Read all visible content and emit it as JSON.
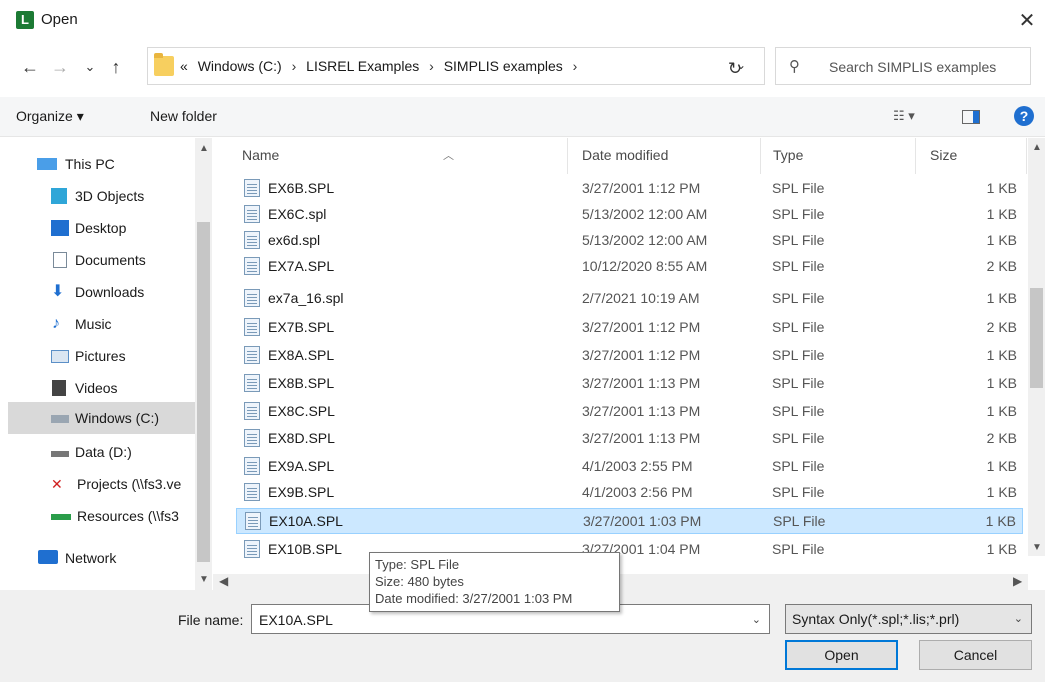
{
  "window": {
    "app_icon_letter": "L",
    "title": "Open",
    "close_glyph": "✕"
  },
  "nav": {
    "back_glyph": "←",
    "forward_glyph": "→",
    "recent_glyph": "⌄",
    "up_glyph": "↑",
    "breadcrumb_prefix": "«",
    "breadcrumbs": [
      "Windows (C:)",
      "LISREL Examples",
      "SIMPLIS examples"
    ],
    "refresh_glyph": "↻",
    "search_placeholder": "Search SIMPLIS examples"
  },
  "toolbar": {
    "organize_label": "Organize ▾",
    "new_folder_label": "New folder",
    "views_glyph": "☷ ▾",
    "help_glyph": "?"
  },
  "sidebar": {
    "items": [
      {
        "label": "This PC",
        "icon": "this-pc-icon",
        "color": "#4a9ee8"
      },
      {
        "label": "3D Objects",
        "icon": "3d-objects-icon",
        "color": "#2fa6d8"
      },
      {
        "label": "Desktop",
        "icon": "desktop-icon",
        "color": "#1f6fd0"
      },
      {
        "label": "Documents",
        "icon": "documents-icon",
        "color": "#7a8a99"
      },
      {
        "label": "Downloads",
        "icon": "downloads-icon",
        "color": "#1f6fd0"
      },
      {
        "label": "Music",
        "icon": "music-icon",
        "color": "#1f6fd0"
      },
      {
        "label": "Pictures",
        "icon": "pictures-icon",
        "color": "#5b8fc7"
      },
      {
        "label": "Videos",
        "icon": "videos-icon",
        "color": "#444444"
      },
      {
        "label": "Windows (C:)",
        "icon": "drive-c-icon",
        "color": "#7a8a99"
      },
      {
        "label": "Data (D:)",
        "icon": "drive-d-icon",
        "color": "#777777"
      },
      {
        "label": "Projects (\\\\fs3.ve",
        "icon": "network-drive-disconnected-icon",
        "color": "#d02020"
      },
      {
        "label": "Resources (\\\\fs3",
        "icon": "network-drive-icon",
        "color": "#2a9d4a"
      },
      {
        "label": "Network",
        "icon": "network-icon",
        "color": "#1f6fd0"
      }
    ]
  },
  "filelist": {
    "columns": {
      "name": "Name",
      "date": "Date modified",
      "type": "Type",
      "size": "Size"
    },
    "rows": [
      {
        "name": "EX6B.SPL",
        "date": "3/27/2001 1:12 PM",
        "type": "SPL File",
        "size": "1 KB"
      },
      {
        "name": "EX6C.spl",
        "date": "5/13/2002 12:00 AM",
        "type": "SPL File",
        "size": "1 KB"
      },
      {
        "name": "ex6d.spl",
        "date": "5/13/2002 12:00 AM",
        "type": "SPL File",
        "size": "1 KB"
      },
      {
        "name": "EX7A.SPL",
        "date": "10/12/2020 8:55 AM",
        "type": "SPL File",
        "size": "2 KB"
      },
      {
        "name": "ex7a_16.spl",
        "date": "2/7/2021 10:19 AM",
        "type": "SPL File",
        "size": "1 KB"
      },
      {
        "name": "EX7B.SPL",
        "date": "3/27/2001 1:12 PM",
        "type": "SPL File",
        "size": "2 KB"
      },
      {
        "name": "EX8A.SPL",
        "date": "3/27/2001 1:12 PM",
        "type": "SPL File",
        "size": "1 KB"
      },
      {
        "name": "EX8B.SPL",
        "date": "3/27/2001 1:13 PM",
        "type": "SPL File",
        "size": "1 KB"
      },
      {
        "name": "EX8C.SPL",
        "date": "3/27/2001 1:13 PM",
        "type": "SPL File",
        "size": "1 KB"
      },
      {
        "name": "EX8D.SPL",
        "date": "3/27/2001 1:13 PM",
        "type": "SPL File",
        "size": "2 KB"
      },
      {
        "name": "EX9A.SPL",
        "date": "4/1/2003 2:55 PM",
        "type": "SPL File",
        "size": "1 KB"
      },
      {
        "name": "EX9B.SPL",
        "date": "4/1/2003 2:56 PM",
        "type": "SPL File",
        "size": "1 KB"
      },
      {
        "name": "EX10A.SPL",
        "date": "3/27/2001 1:03 PM",
        "type": "SPL File",
        "size": "1 KB"
      },
      {
        "name": "EX10B.SPL",
        "date": "3/27/2001 1:04 PM",
        "type": "SPL File",
        "size": "1 KB"
      }
    ],
    "selected_index": 12
  },
  "tooltip": {
    "type_line": "Type: SPL File",
    "size_line": "Size: 480 bytes",
    "date_line": "Date modified: 3/27/2001 1:03 PM"
  },
  "footer": {
    "file_name_label": "File name:",
    "file_name_value": "EX10A.SPL",
    "filter_value": "Syntax Only(*.spl;*.lis;*.prl)",
    "open_label": "Open",
    "cancel_label": "Cancel"
  }
}
